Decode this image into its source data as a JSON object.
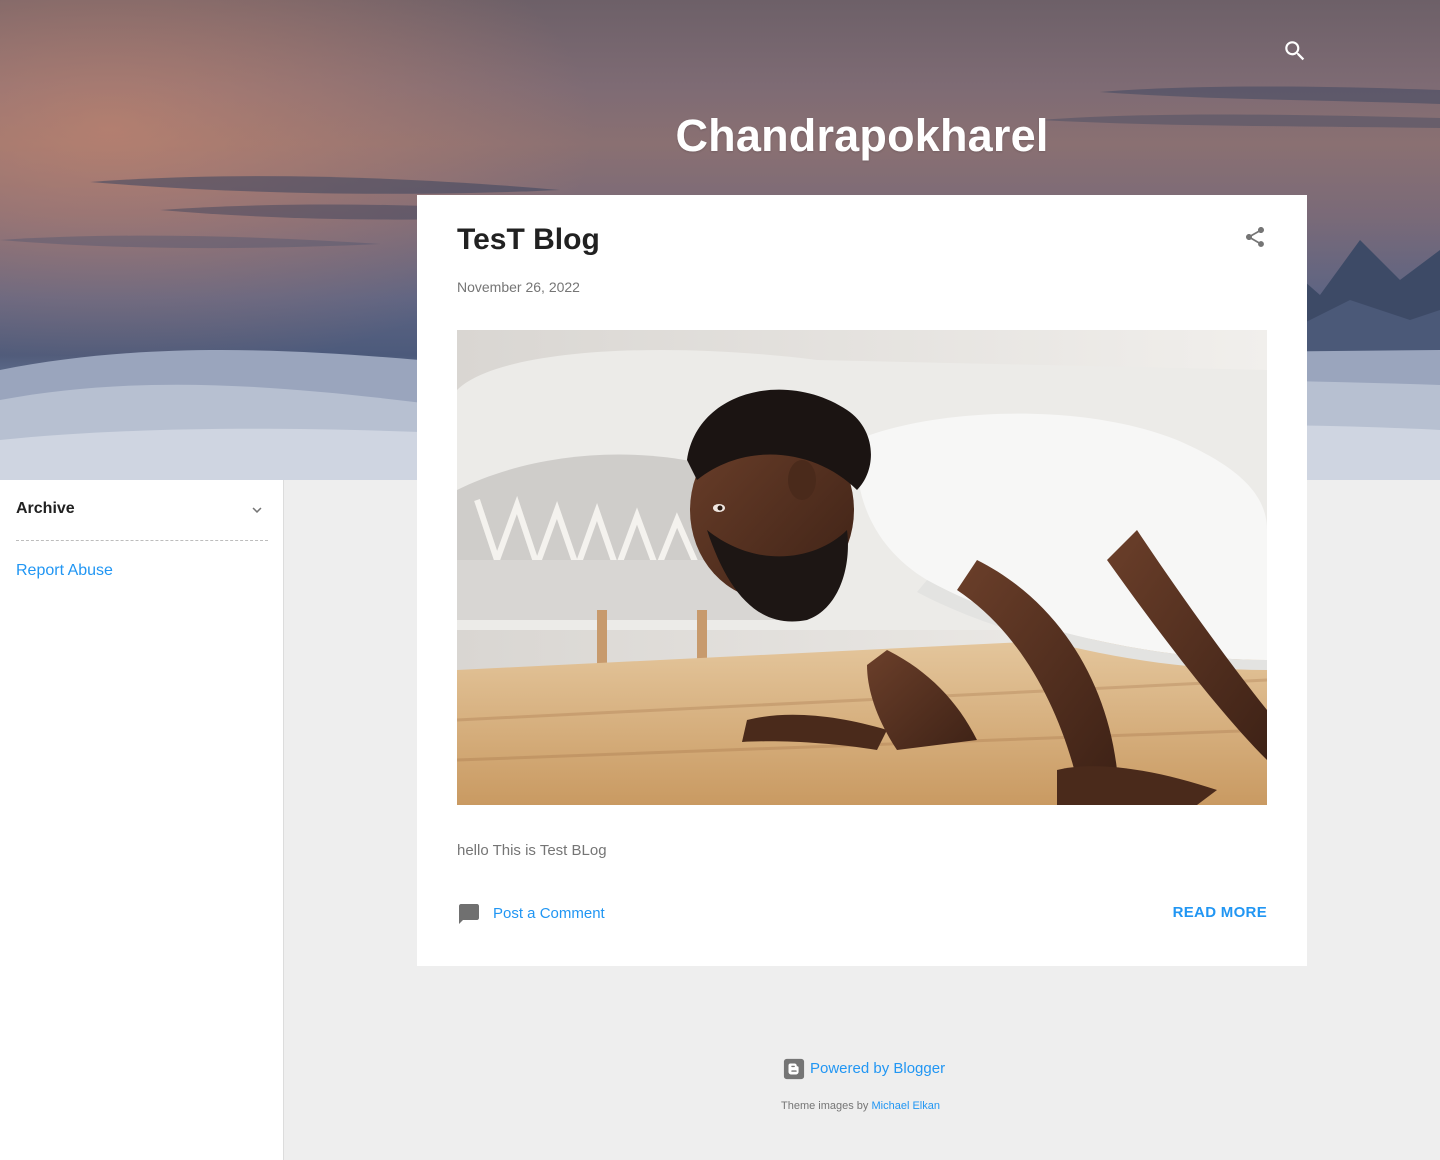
{
  "header": {
    "blog_title": "Chandrapokharel",
    "search_icon": "search-icon"
  },
  "sidebar": {
    "archive_label": "Archive",
    "archive_icon": "chevron-down-icon",
    "report_abuse_label": "Report Abuse"
  },
  "post": {
    "title": "TesT Blog",
    "date": "November 26, 2022",
    "share_icon": "share-icon",
    "image_description_icon": "photo",
    "snippet": "hello This is Test BLog",
    "comment_label": "Post a Comment",
    "comment_icon": "comment-icon",
    "read_more_label": "READ MORE"
  },
  "footer": {
    "powered_label": "Powered by Blogger",
    "blogger_icon": "blogger-icon",
    "theme_prefix": "Theme images by",
    "theme_author": "Michael Elkan"
  },
  "colors": {
    "accent": "#2196f3",
    "background": "#eeeeee",
    "card": "#ffffff",
    "text_primary": "#212121",
    "text_secondary": "#757575"
  }
}
